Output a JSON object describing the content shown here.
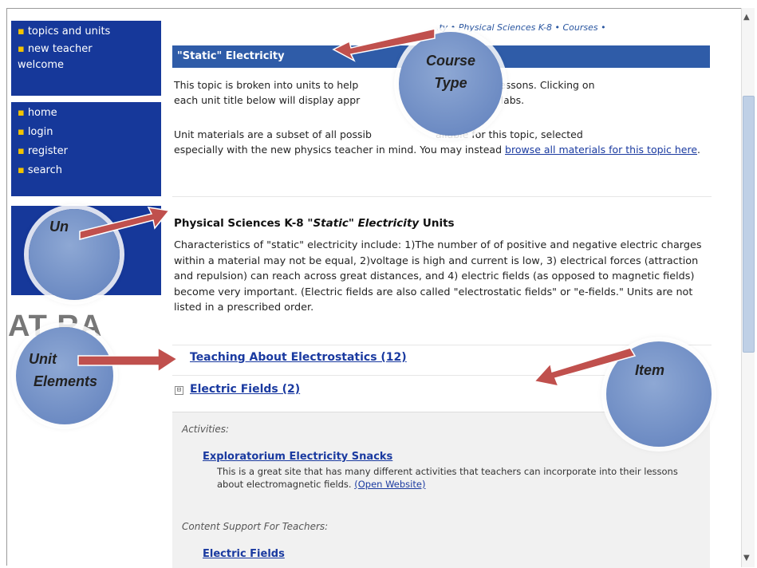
{
  "sidebar": {
    "group1": [
      "topics and units",
      "new teacher welcome"
    ],
    "group2": [
      "home",
      "login",
      "register",
      "search"
    ]
  },
  "breadcrumb": "...ty • Physical Sciences K-8 • Courses •",
  "topic": {
    "title": "\"Static\" Electricity",
    "intro_line1": "This topic is broken into units to help",
    "intro_line1_end": "ve, effective lessons. Clicking on",
    "intro_line2": "each unit title below will display appr",
    "intro_line2_end": "son plans, or labs.",
    "materials_line1": "Unit materials are a subset of all possib",
    "materials_line1_end": "ailable for this topic, selected",
    "materials_line2": "especially with the new physics teacher in mind. You may instead",
    "materials_link": "browse all materials for this topic here",
    "materials_end": "."
  },
  "section": {
    "title_prefix": "Physical Sciences K-8",
    "title_quote": "\"Static\"",
    "title_italic": "Electricity",
    "title_suffix": "Units",
    "desc": "Characteristics of \"static\" electricity include: 1)The number of of positive and negative electric charges within a material may not be equal, 2)voltage is high and current is low, 3) electrical forces (attraction and repulsion) can reach across great distances, and 4) electric fields (as opposed to magnetic fields) become very important. (Electric fields are also called \"electrostatic fields\" or \"e-fields.\" Units are not listed in a prescribed order."
  },
  "units": [
    {
      "label": "Teaching About Electrostatics (12)"
    },
    {
      "label": "Electric Fields (2)",
      "expander": "⊟"
    }
  ],
  "pane": {
    "activities_heading": "Activities:",
    "activity_title": "Exploratorium Electricity Snacks",
    "activity_desc": "This is a great site that has many different activities that teachers can incorporate into their lessons about electromagnetic fields.",
    "activity_link": "(Open Website)",
    "support_heading": "Content Support For Teachers:",
    "support_title": "Electric Fields"
  },
  "logo_fragment": "AT RA",
  "annotations": {
    "course_type": [
      "Course",
      "Type"
    ],
    "unit": "Un",
    "unit_elements": [
      "Unit",
      "Elements"
    ],
    "item": "Item"
  },
  "colors": {
    "nav_blue": "#16389a",
    "title_bar": "#2f5ca8",
    "link": "#1a3aa0",
    "arrow": "#c0504d",
    "bubble": "#7a97cc"
  }
}
